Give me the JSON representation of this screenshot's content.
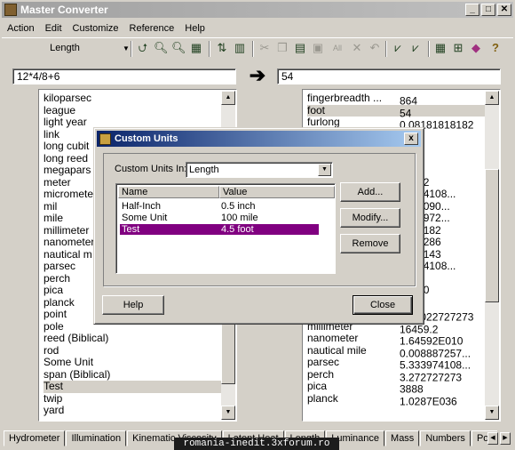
{
  "app": {
    "title": "Master Converter"
  },
  "window_buttons": {
    "minimize": "_",
    "maximize": "□",
    "close": "✕"
  },
  "menu": [
    "Action",
    "Edit",
    "Customize",
    "Reference",
    "Help"
  ],
  "toolbar": {
    "category": "Length"
  },
  "expression": {
    "input": "12*4/8+6",
    "result": "54",
    "arrow": "➔"
  },
  "left_units": [
    "kiloparsec",
    "league",
    "light year",
    "link",
    "long cubit",
    "long reed",
    "megapars",
    "meter",
    "micrometer",
    "mil",
    "mile",
    "millimeter",
    "nanometer",
    "nautical m",
    "parsec",
    "perch",
    "pica",
    "planck",
    "point",
    "pole",
    "reed (Biblical)",
    "rod",
    "Some Unit",
    "span (Biblical)",
    "Test",
    "twip",
    "yard"
  ],
  "left_selected": "Test",
  "right_rows": [
    {
      "unit": "fingerbreadth ...",
      "value": "864"
    },
    {
      "unit": "foot",
      "value": "54"
    },
    {
      "unit": "furlong",
      "value": "0.08181818182"
    },
    {
      "unit": "",
      "value": "6"
    },
    {
      "unit": "",
      "value": ""
    },
    {
      "unit": "",
      "value": "4592"
    },
    {
      "unit": "",
      "value": ""
    },
    {
      "unit": "",
      "value": "64592"
    },
    {
      "unit": "",
      "value": "33974108..."
    },
    {
      "unit": "",
      "value": "3409090..."
    },
    {
      "unit": "",
      "value": "9775972..."
    },
    {
      "unit": "",
      "value": "1818182"
    },
    {
      "unit": "",
      "value": "5714286"
    },
    {
      "unit": "",
      "value": "2857143"
    },
    {
      "unit": "",
      "value": "33974108..."
    },
    {
      "unit": "",
      "value": "592"
    },
    {
      "unit": "",
      "value": "59200"
    },
    {
      "unit": "",
      "value": "000"
    },
    {
      "unit": "mile",
      "value": "0.01022727273"
    },
    {
      "unit": "millimeter",
      "value": "16459.2"
    },
    {
      "unit": "nanometer",
      "value": "1.64592E010"
    },
    {
      "unit": "nautical mile",
      "value": "0.008887257..."
    },
    {
      "unit": "parsec",
      "value": "5.333974108..."
    },
    {
      "unit": "perch",
      "value": "3.272727273"
    },
    {
      "unit": "pica",
      "value": "3888"
    },
    {
      "unit": "planck",
      "value": "1.0287E036"
    }
  ],
  "right_selected": "foot",
  "tabs": [
    "Hydrometer",
    "Illumination",
    "Kinematic Viscosity",
    "Latent Heat",
    "Length",
    "Luminance",
    "Mass",
    "Numbers",
    "Power",
    "Pressure"
  ],
  "watermark": "romania-inedit.3xforum.ro",
  "dialog": {
    "title": "Custom Units",
    "close": "x",
    "custom_units_label": "Custom Units In:",
    "custom_units_value": "Length",
    "columns": [
      "Name",
      "Value"
    ],
    "rows": [
      {
        "name": "Half-Inch",
        "value": "0.5 inch"
      },
      {
        "name": "Some Unit",
        "value": "100 mile"
      },
      {
        "name": "Test",
        "value": "4.5 foot"
      }
    ],
    "selected_row": "Test",
    "add_label": "Add...",
    "modify_label": "Modify...",
    "remove_label": "Remove",
    "help_label": "Help",
    "close_label": "Close"
  },
  "colors": {
    "selection": "#800080",
    "dialog_title": "#0a246a"
  }
}
